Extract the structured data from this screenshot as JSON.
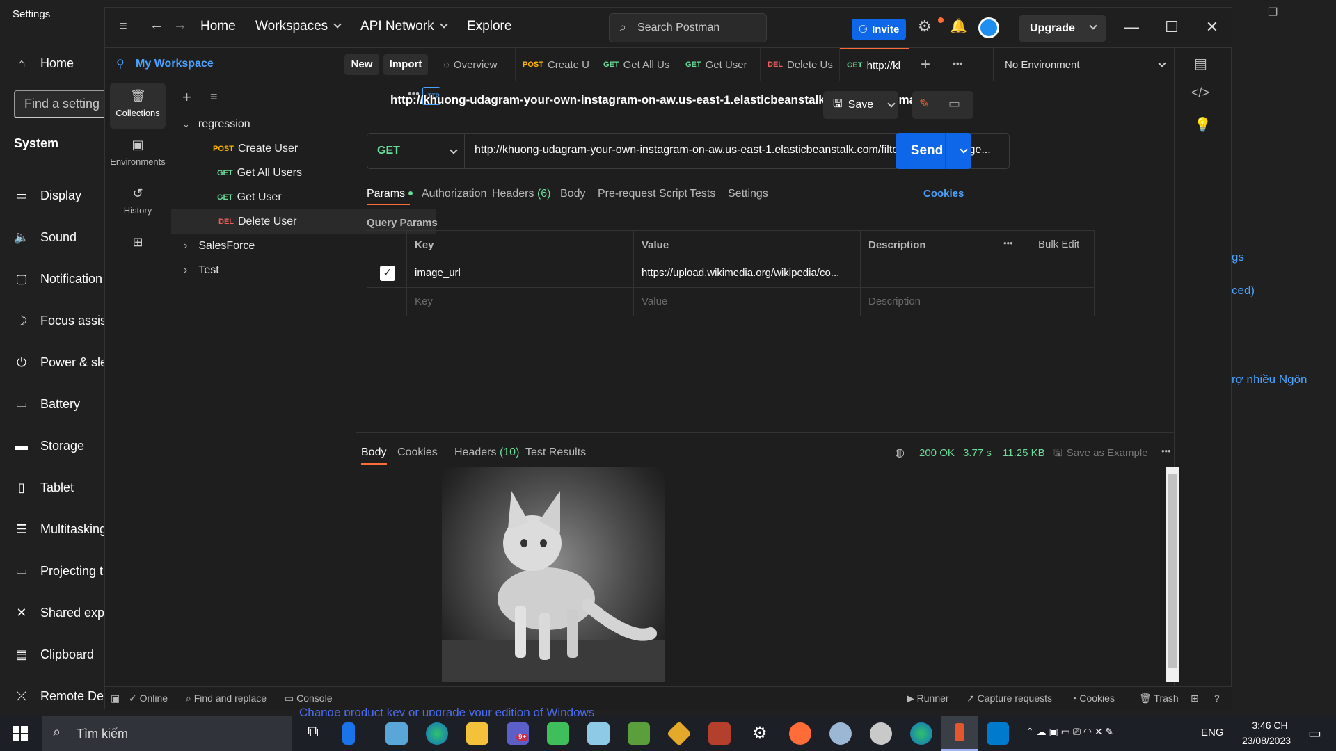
{
  "settings": {
    "window_title": "Settings",
    "find_placeholder": "Find a setting",
    "section": "System",
    "nav": [
      {
        "icon": "home-icon",
        "label": "Home"
      },
      {
        "icon": "display-icon",
        "label": "Display"
      },
      {
        "icon": "sound-icon",
        "label": "Sound"
      },
      {
        "icon": "notification-icon",
        "label": "Notification"
      },
      {
        "icon": "focus-assist-icon",
        "label": "Focus assist"
      },
      {
        "icon": "power-icon",
        "label": "Power & sle"
      },
      {
        "icon": "battery-icon",
        "label": "Battery"
      },
      {
        "icon": "storage-icon",
        "label": "Storage"
      },
      {
        "icon": "tablet-icon",
        "label": "Tablet"
      },
      {
        "icon": "multitasking-icon",
        "label": "Multitasking"
      },
      {
        "icon": "projecting-icon",
        "label": "Projecting t"
      },
      {
        "icon": "shared-experiences-icon",
        "label": "Shared expe"
      },
      {
        "icon": "clipboard-icon",
        "label": "Clipboard"
      },
      {
        "icon": "remote-desktop-icon",
        "label": "Remote Des"
      }
    ],
    "right_links": [
      "gs",
      "ced)",
      "rợ nhiều Ngôn"
    ]
  },
  "postman": {
    "top_nav": {
      "home": "Home",
      "workspaces": "Workspaces",
      "api_network": "API Network",
      "explore": "Explore",
      "search_placeholder": "Search Postman",
      "invite": "Invite",
      "upgrade": "Upgrade"
    },
    "workspace": {
      "name": "My Workspace",
      "new": "New",
      "import": "Import"
    },
    "rail": [
      {
        "icon": "collections-icon",
        "label": "Collections"
      },
      {
        "icon": "environments-icon",
        "label": "Environments"
      },
      {
        "icon": "history-icon",
        "label": "History"
      }
    ],
    "tree": {
      "collection": "regression",
      "requests": [
        {
          "method": "POST",
          "name": "Create User"
        },
        {
          "method": "GET",
          "name": "Get All Users"
        },
        {
          "method": "GET",
          "name": "Get User"
        },
        {
          "method": "DEL",
          "name": "Delete User"
        }
      ],
      "others": [
        "SalesForce",
        "Test"
      ]
    },
    "tabs": [
      {
        "method": "",
        "label": "Overview"
      },
      {
        "method": "POST",
        "label": "Create U"
      },
      {
        "method": "GET",
        "label": "Get All Us"
      },
      {
        "method": "GET",
        "label": "Get User"
      },
      {
        "method": "DEL",
        "label": "Delete Us"
      },
      {
        "method": "GET",
        "label": "http://kl"
      }
    ],
    "environment": "No Environment",
    "request": {
      "title": "http://khuong-udagram-your-own-instagram-on-aw.us-east-1.elasticbeanstalk.com/filteredimage...",
      "save": "Save",
      "method": "GET",
      "url": "http://khuong-udagram-your-own-instagram-on-aw.us-east-1.elasticbeanstalk.com/filteredimage?image...",
      "send": "Send",
      "tabs": {
        "params": "Params",
        "authorization": "Authorization",
        "headers": "Headers",
        "headers_count": "(6)",
        "body": "Body",
        "prerequest": "Pre-request Script",
        "tests": "Tests",
        "settings": "Settings",
        "cookies": "Cookies"
      },
      "query_label": "Query Params",
      "table": {
        "key": "Key",
        "value": "Value",
        "description": "Description",
        "bulk_edit": "Bulk Edit",
        "row_key": "image_url",
        "row_value": "https://upload.wikimedia.org/wikipedia/co...",
        "placeholder_key": "Key",
        "placeholder_value": "Value",
        "placeholder_desc": "Description"
      }
    },
    "response": {
      "tabs": {
        "body": "Body",
        "cookies": "Cookies",
        "headers": "Headers",
        "headers_count": "(10)",
        "test_results": "Test Results"
      },
      "status": "200 OK",
      "time": "3.77 s",
      "size": "11.25 KB",
      "save_example": "Save as Example"
    },
    "statusbar": {
      "online": "Online",
      "find_replace": "Find and replace",
      "console": "Console",
      "runner": "Runner",
      "capture": "Capture requests",
      "cookies": "Cookies",
      "trash": "Trash"
    }
  },
  "taskbar": {
    "search_placeholder": "Tìm kiếm",
    "language": "ENG",
    "time": "3:46 CH",
    "date": "23/08/2023",
    "teams_badge": "9+"
  },
  "activation_text": "Change product key or upgrade your edition of Windows",
  "colors": {
    "accent": "#ff6c37",
    "primary": "#0e67e8",
    "get": "#6bdd9a",
    "post": "#ffb400",
    "del": "#f05d5d"
  }
}
